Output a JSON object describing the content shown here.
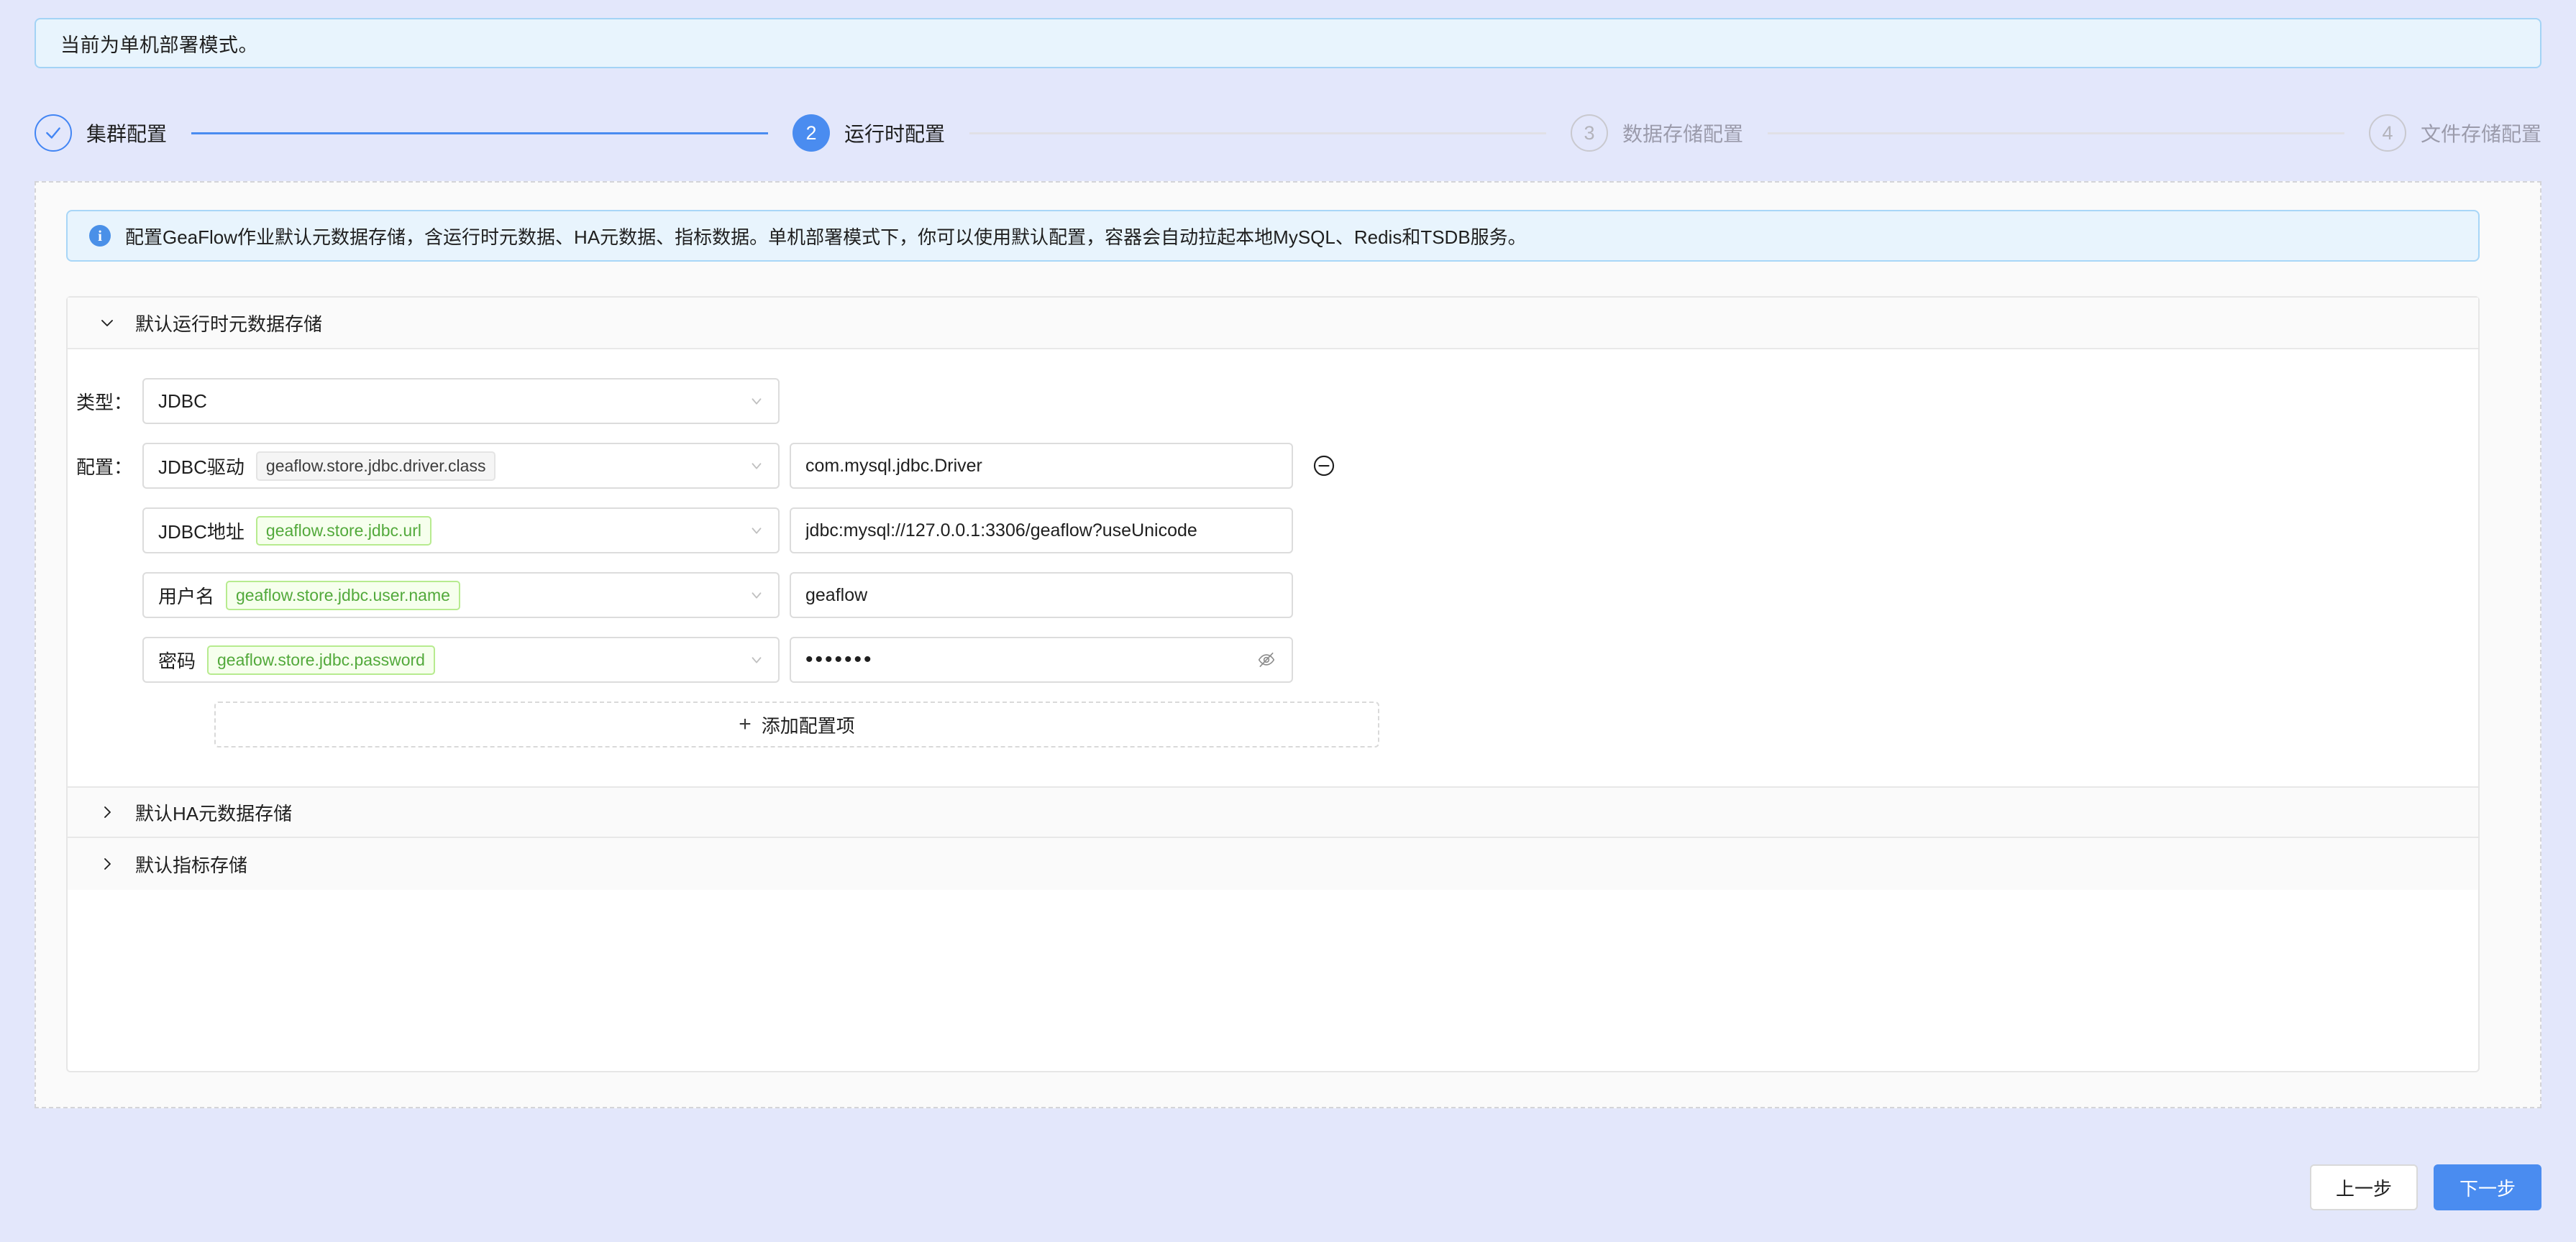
{
  "top_notice": {
    "text": "当前为单机部署模式。"
  },
  "steps": [
    {
      "number": "1",
      "label": "集群配置",
      "state": "done",
      "icon": "check-icon"
    },
    {
      "number": "2",
      "label": "运行时配置",
      "state": "active"
    },
    {
      "number": "3",
      "label": "数据存储配置",
      "state": "todo"
    },
    {
      "number": "4",
      "label": "文件存储配置",
      "state": "todo"
    }
  ],
  "info_alert": {
    "icon": "info-circle-icon",
    "text": "配置GeaFlow作业默认元数据存储，含运行时元数据、HA元数据、指标数据。单机部署模式下，你可以使用默认配置，容器会自动拉起本地MySQL、Redis和TSDB服务。"
  },
  "panels": [
    {
      "title": "默认运行时元数据存储",
      "expanded": true,
      "chevron": "chevron-down-icon"
    },
    {
      "title": "默认HA元数据存储",
      "expanded": false,
      "chevron": "chevron-right-icon"
    },
    {
      "title": "默认指标存储",
      "expanded": false,
      "chevron": "chevron-right-icon"
    }
  ],
  "form": {
    "type_label": "类型：",
    "type_value": "JDBC",
    "config_label": "配置：",
    "rows": [
      {
        "name": "JDBC驱动",
        "tag": "geaflow.store.jdbc.driver.class",
        "tag_style": "grey",
        "value": "com.mysql.jdbc.Driver",
        "is_password": false,
        "has_remove": true
      },
      {
        "name": "JDBC地址",
        "tag": "geaflow.store.jdbc.url",
        "tag_style": "green",
        "value": "jdbc:mysql://127.0.0.1:3306/geaflow?useUnicode",
        "is_password": false,
        "has_remove": false
      },
      {
        "name": "用户名",
        "tag": "geaflow.store.jdbc.user.name",
        "tag_style": "green",
        "value": "geaflow",
        "is_password": false,
        "has_remove": false
      },
      {
        "name": "密码",
        "tag": "geaflow.store.jdbc.password",
        "tag_style": "green",
        "value": "•••••••",
        "is_password": true,
        "has_remove": false
      }
    ],
    "add_config_label": "添加配置项",
    "add_config_icon": "plus-icon"
  },
  "footer": {
    "prev_label": "上一步",
    "next_label": "下一步"
  },
  "colors": {
    "accent": "#4a8cf0",
    "page_bg": "#e3e7fb",
    "info_bg": "#e8f4fd",
    "info_border": "#a8d6f7",
    "tag_green_text": "#52a93b",
    "tag_green_bg": "#f6ffed"
  }
}
